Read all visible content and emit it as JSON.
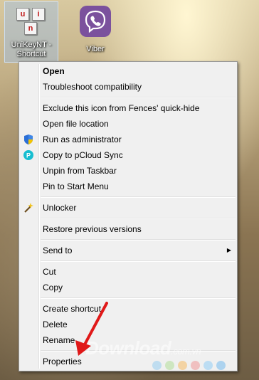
{
  "desktop": {
    "icons": [
      {
        "label": "UniKeyNT - Shortcut",
        "label_line1": "UniKeyNT -",
        "label_line2": "Shortcut"
      },
      {
        "label": "Viber"
      }
    ]
  },
  "context_menu": {
    "items": [
      {
        "label": "Open",
        "bold": true
      },
      {
        "label": "Troubleshoot compatibility"
      },
      {
        "label": "Exclude this icon from Fences' quick-hide"
      },
      {
        "label": "Open file location"
      },
      {
        "label": "Run as administrator",
        "icon": "uac-shield-icon"
      },
      {
        "label": "Copy to pCloud Sync",
        "icon": "pcloud-icon"
      },
      {
        "label": "Unpin from Taskbar"
      },
      {
        "label": "Pin to Start Menu"
      },
      {
        "label": "Unlocker",
        "icon": "magic-wand-icon"
      },
      {
        "label": "Restore previous versions"
      },
      {
        "label": "Send to",
        "has_submenu": true
      },
      {
        "label": "Cut"
      },
      {
        "label": "Copy"
      },
      {
        "label": "Create shortcut"
      },
      {
        "label": "Delete"
      },
      {
        "label": "Rename"
      },
      {
        "label": "Properties"
      }
    ]
  },
  "watermark": {
    "text": "Download",
    "suffix": ".com.vn"
  },
  "colors": {
    "accent_red": "#e01818",
    "viber_purple": "#7b519d",
    "unikey_red": "#c01818"
  }
}
